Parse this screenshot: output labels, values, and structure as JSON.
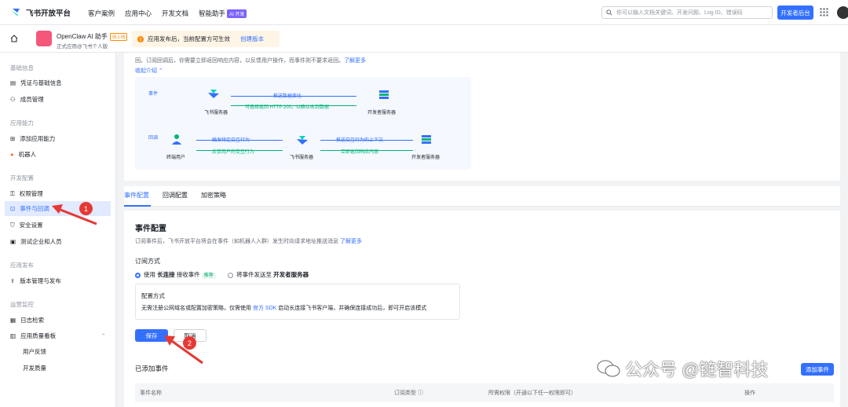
{
  "topnav": {
    "brand": "飞书开放平台",
    "links": [
      "客户案例",
      "应用中心",
      "开发文档",
      "智能助手"
    ],
    "ai_badge": "AI 开发",
    "search_placeholder": "你可以输入文档关键词、开发问题、Log ID、错误码",
    "dev_console": "开发者后台"
  },
  "subheader": {
    "app_name": "OpenClaw AI 助手",
    "app_tag": "待上线",
    "app_sub": "正式应用@飞书个人版",
    "notice": "应用发布后，当前配置方可生效",
    "notice_link": "创建版本"
  },
  "sidebar": {
    "sections": [
      {
        "title": "基础信息",
        "items": [
          "凭证与基础信息",
          "成员管理"
        ]
      },
      {
        "title": "应用能力",
        "items": [
          "添加应用能力",
          "机器人"
        ]
      },
      {
        "title": "开发配置",
        "items": [
          "权限管理",
          "事件与回调",
          "安全设置",
          "测试企业和人员"
        ]
      },
      {
        "title": "应用发布",
        "items": [
          "版本管理与发布"
        ]
      },
      {
        "title": "运营监控",
        "items": [
          "日志检索",
          "应用质量看板"
        ]
      }
    ],
    "quality_sub": [
      "用户反馈",
      "开发质量"
    ]
  },
  "intro": {
    "line1": "回。订阅回调后，你需要立即返回响应内容，以反馈用户操作，而事件则不要求返回。",
    "learn_more": "了解更多",
    "collapse": "收起介绍"
  },
  "diagram": {
    "event_label": "事件",
    "callback_label": "回调",
    "feishu_server": "飞书服务器",
    "dev_server": "开发者服务器",
    "end_user": "终端用户",
    "push_data": "推送数据变化",
    "choose_return": "可选择返回 HTTP 200，以确认收到数据",
    "trigger": "触发特定交互行为",
    "feedback": "反馈用户的交互行为",
    "push_context": "推送交互行为的上下文",
    "return_now": "立即返回响应内容"
  },
  "tabs": [
    "事件配置",
    "回调配置",
    "加密策略"
  ],
  "event_config": {
    "title": "事件配置",
    "desc": "订阅事件后，飞书开放平台将会在事件（如机器人入群）发生时向请求地址推送消息",
    "desc_link": "了解更多",
    "sub_method": "订阅方式",
    "opt1_pre": "使用",
    "opt1_bold": "长连接",
    "opt1_post": "接收事件",
    "opt1_tag": "推荐",
    "opt2_pre": "将事件发送至",
    "opt2_bold": "开发者服务器",
    "config_title": "配置方式",
    "config_pre": "无需注册公网域名或配置加密策略，仅需使用",
    "config_link": "官方 SDK",
    "config_post": "启动长连接飞书客户端，并确保连接成功后，即可开启该模式",
    "save": "保存",
    "cancel": "取消",
    "added_events": "已添加事件",
    "add_event_btn": "添加事件",
    "columns": [
      "事件名称",
      "订阅类型",
      "所需权限（开通以下任一权限即可）",
      "操作"
    ]
  },
  "annotations": [
    "1",
    "2"
  ],
  "watermark": "公众号 @链智科技",
  "colors": {
    "accent": "#3370ff",
    "annotation": "#e53935"
  }
}
